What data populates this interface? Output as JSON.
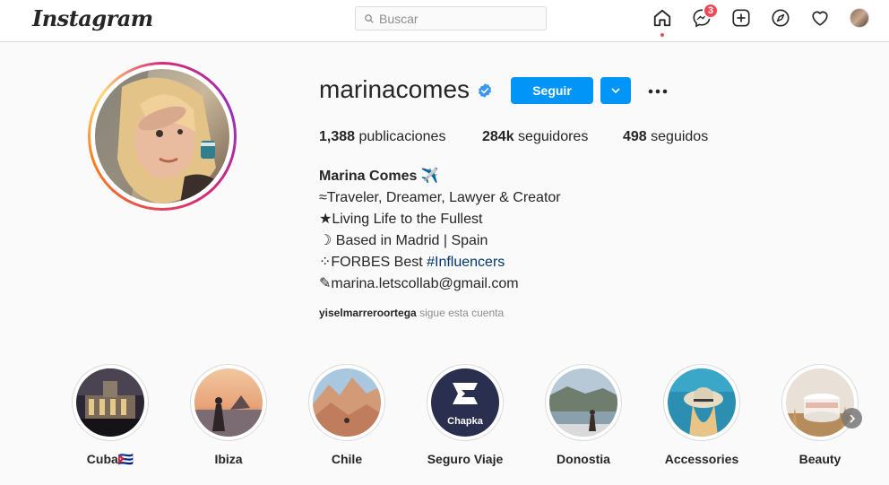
{
  "header": {
    "logo_text": "Instagram",
    "search_placeholder": "Buscar",
    "messages_badge": "3",
    "icons": [
      "home-icon",
      "messenger-icon",
      "new-post-icon",
      "explore-icon",
      "activity-heart-icon",
      "profile-avatar"
    ]
  },
  "profile": {
    "username": "marinacomes",
    "verified": true,
    "follow_label": "Seguir",
    "stats": {
      "posts_value": "1,388",
      "posts_label": "publicaciones",
      "followers_value": "284k",
      "followers_label": "seguidores",
      "following_value": "498",
      "following_label": "seguidos"
    },
    "bio": {
      "name": "Marina Comes ✈️",
      "lines": [
        "≈Traveler, Dreamer, Lawyer & Creator",
        "★Living Life to the Fullest",
        "☽ Based in Madrid | Spain"
      ],
      "forbes_prefix": "⁘FORBES Best ",
      "forbes_hashtag": "#Influencers",
      "email_line": "✎marina.letscollab@gmail.com"
    },
    "followed_by_user": "yiselmarreroortega",
    "followed_by_text": " sigue esta cuenta"
  },
  "highlights": [
    {
      "label": "Cuba🇨🇺"
    },
    {
      "label": "Ibiza"
    },
    {
      "label": "Chile"
    },
    {
      "label": "Seguro Viaje",
      "logo_text": "Chapka"
    },
    {
      "label": "Donostia"
    },
    {
      "label": "Accessories"
    },
    {
      "label": "Beauty"
    }
  ],
  "colors": {
    "accent": "#0095f6",
    "badge": "#ed4956",
    "link": "#00376b"
  }
}
